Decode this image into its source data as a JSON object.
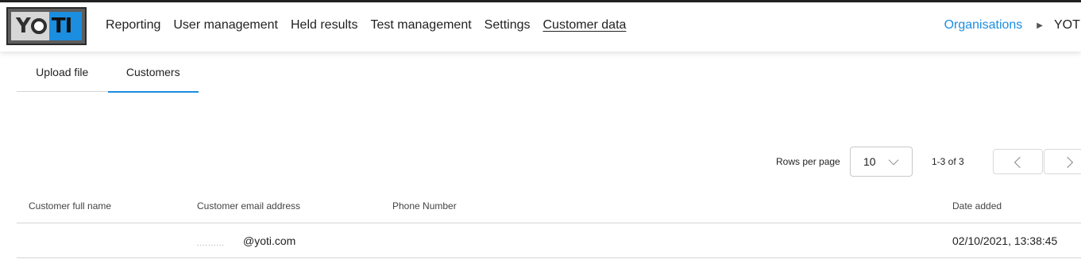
{
  "brand": {
    "logo_text": "YOTI",
    "accent": "#1b8ee0"
  },
  "nav": {
    "items": [
      {
        "label": "Reporting"
      },
      {
        "label": "User management"
      },
      {
        "label": "Held results"
      },
      {
        "label": "Test management"
      },
      {
        "label": "Settings"
      },
      {
        "label": "Customer data",
        "active": true
      }
    ]
  },
  "breadcrumb": {
    "link": "Organisations",
    "separator_icon": "triangle-right-icon",
    "current": "YOTI"
  },
  "tabs": [
    {
      "label": "Upload file",
      "active": false
    },
    {
      "label": "Customers",
      "active": true
    }
  ],
  "pagination": {
    "rows_per_page_label": "Rows per page",
    "rows_per_page_value": "10",
    "range_text": "1-3 of 3",
    "prev_icon": "chevron-left-icon",
    "next_icon": "chevron-right-icon"
  },
  "table": {
    "columns": [
      "Customer full name",
      "Customer email address",
      "Phone Number",
      "Date added"
    ],
    "rows": [
      {
        "name": "",
        "email_redacted": "..........",
        "email_domain": "@yoti.com",
        "phone": "",
        "date": "02/10/2021, 13:38:45"
      }
    ]
  }
}
